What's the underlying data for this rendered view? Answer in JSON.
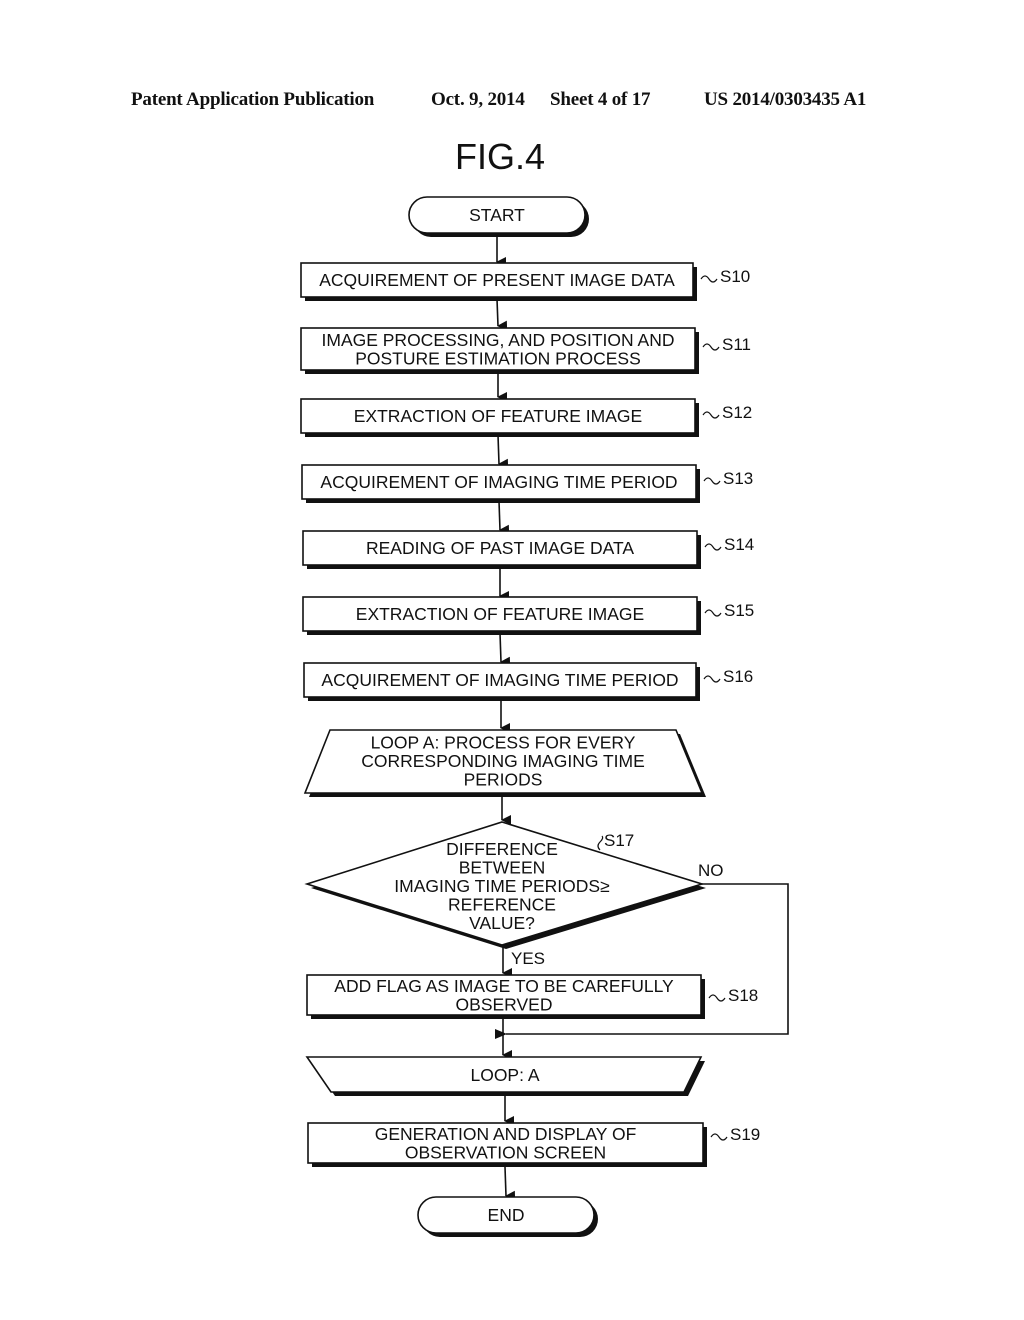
{
  "header": {
    "publication": "Patent Application Publication",
    "date": "Oct. 9, 2014",
    "sheet": "Sheet 4 of 17",
    "number": "US 2014/0303435 A1"
  },
  "figure": {
    "title": "FIG.4",
    "start": "START",
    "end": "END",
    "steps": {
      "s10": {
        "label": "S10",
        "lines": [
          "ACQUIREMENT OF PRESENT IMAGE DATA"
        ]
      },
      "s11": {
        "label": "S11",
        "lines": [
          "IMAGE PROCESSING, AND POSITION AND",
          "POSTURE ESTIMATION PROCESS"
        ]
      },
      "s12": {
        "label": "S12",
        "lines": [
          "EXTRACTION OF FEATURE IMAGE"
        ]
      },
      "s13": {
        "label": "S13",
        "lines": [
          "ACQUIREMENT OF IMAGING TIME PERIOD"
        ]
      },
      "s14": {
        "label": "S14",
        "lines": [
          "READING OF PAST IMAGE DATA"
        ]
      },
      "s15": {
        "label": "S15",
        "lines": [
          "EXTRACTION OF FEATURE IMAGE"
        ]
      },
      "s16": {
        "label": "S16",
        "lines": [
          "ACQUIREMENT OF IMAGING TIME PERIOD"
        ]
      },
      "s17": {
        "label": "S17",
        "lines": [
          "DIFFERENCE",
          "BETWEEN",
          "IMAGING TIME PERIODS≥",
          "REFERENCE",
          "VALUE?"
        ]
      },
      "s18": {
        "label": "S18",
        "lines": [
          "ADD FLAG AS IMAGE TO BE CAREFULLY",
          "OBSERVED"
        ]
      },
      "s19": {
        "label": "S19",
        "lines": [
          "GENERATION AND DISPLAY OF",
          "OBSERVATION SCREEN"
        ]
      }
    },
    "loop_start": {
      "lines": [
        "LOOP A: PROCESS FOR EVERY",
        "CORRESPONDING IMAGING TIME",
        "PERIODS"
      ]
    },
    "loop_end": {
      "lines": [
        "LOOP: A"
      ]
    },
    "branch_yes": "YES",
    "branch_no": "NO"
  }
}
